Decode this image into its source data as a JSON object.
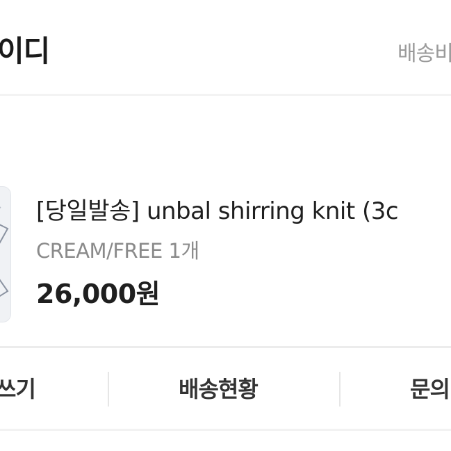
{
  "header": {
    "store_name": "이디",
    "shipping_link": "배송비"
  },
  "order_item": {
    "title": "[당일발송] unbal shirring knit (3c",
    "option": "CREAM/FREE 1개",
    "price": "26,000원"
  },
  "actions": [
    {
      "label": "쓰기"
    },
    {
      "label": "배송현황"
    },
    {
      "label": "문의"
    }
  ],
  "colors": {
    "text_primary": "#1f1f1f",
    "text_secondary": "#8a8a8a",
    "divider": "#ececec"
  }
}
